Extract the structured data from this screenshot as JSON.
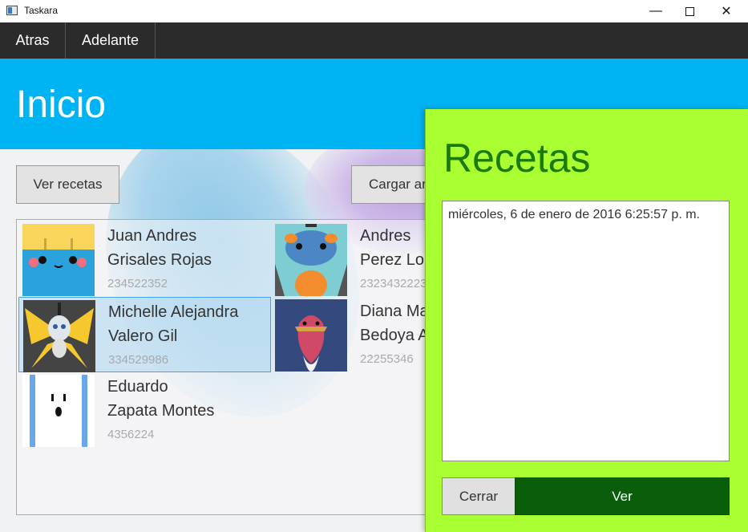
{
  "window": {
    "title": "Taskara",
    "minimize": "—",
    "close": "✕"
  },
  "nav": {
    "back": "Atras",
    "forward": "Adelante"
  },
  "header": {
    "title": "Inicio",
    "color": "#00b3f2"
  },
  "toolbar": {
    "view_recipes": "Ver recetas",
    "load": "Cargar ar"
  },
  "contacts": [
    {
      "first": "Juan Andres",
      "last": "Grisales Rojas",
      "phone": "234522352",
      "avatar": "yellow-blue-creature"
    },
    {
      "first": "Andres",
      "last": "Perez Lop",
      "phone": "2323432223",
      "avatar": "teal-orange-creature"
    },
    {
      "first": "Michelle Alejandra",
      "last": "Valero Gil",
      "phone": "334529986",
      "avatar": "yellow-butterfly-creature",
      "selected": true
    },
    {
      "first": "Diana Ma",
      "last": "Bedoya A",
      "phone": "22255346",
      "avatar": "red-bird-creature"
    },
    {
      "first": "Eduardo",
      "last": "Zapata Montes",
      "phone": "4356224",
      "avatar": "white-ghost-creature"
    }
  ],
  "flyout": {
    "title": "Recetas",
    "text": "miércoles, 6 de enero de 2016 6:25:57 p. m.",
    "close": "Cerrar",
    "view": "Ver",
    "color": "#aaff33",
    "accent": "#0a5e0a"
  }
}
